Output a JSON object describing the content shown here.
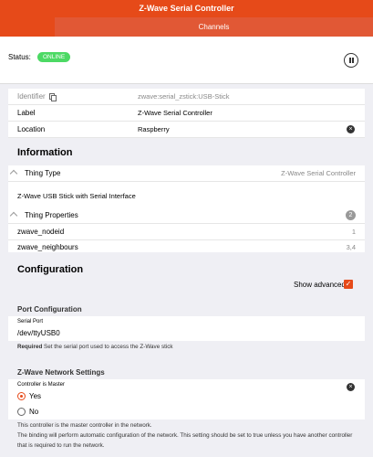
{
  "header": {
    "title": "Z-Wave Serial Controller",
    "tab": "Channels"
  },
  "status": {
    "label": "Status:",
    "badge": "ONLINE",
    "badge_color": "#4cd964",
    "action_icon": "pause-icon"
  },
  "properties": {
    "identifier_label": "Identifier",
    "identifier_value": "zwave:serial_zstick:USB-Stick",
    "label_label": "Label",
    "label_value": "Z-Wave Serial Controller",
    "location_label": "Location",
    "location_value": "Raspberry"
  },
  "information": {
    "title": "Information",
    "thing_type_label": "Thing Type",
    "thing_type_value": "Z-Wave Serial Controller",
    "description": "Z-Wave USB Stick with Serial Interface",
    "thing_properties_label": "Thing Properties",
    "thing_properties_count": "2",
    "props": [
      {
        "key": "zwave_nodeid",
        "value": "1"
      },
      {
        "key": "zwave_neighbours",
        "value": "3,4"
      }
    ]
  },
  "configuration": {
    "title": "Configuration",
    "show_advanced": "Show advanced",
    "show_advanced_checked": true,
    "port_group": "Port Configuration",
    "serial_port_label": "Serial Port",
    "serial_port_value": "/dev/ttyUSB0",
    "serial_help_bold": "Required",
    "serial_help": " Set the serial port used to access the Z-Wave stick",
    "network_group": "Z-Wave Network Settings",
    "master_label": "Controller is Master",
    "option_yes": "Yes",
    "option_no": "No",
    "selected": "Yes",
    "master_help_1": "This controller is the master controller in the network.",
    "master_help_2": "The binding will perform automatic configuration of the network. This setting should be set to true unless you have another controller",
    "master_help_3": "that is required to run the network."
  },
  "colors": {
    "accent": "#e64a19",
    "background": "#efeff4"
  }
}
